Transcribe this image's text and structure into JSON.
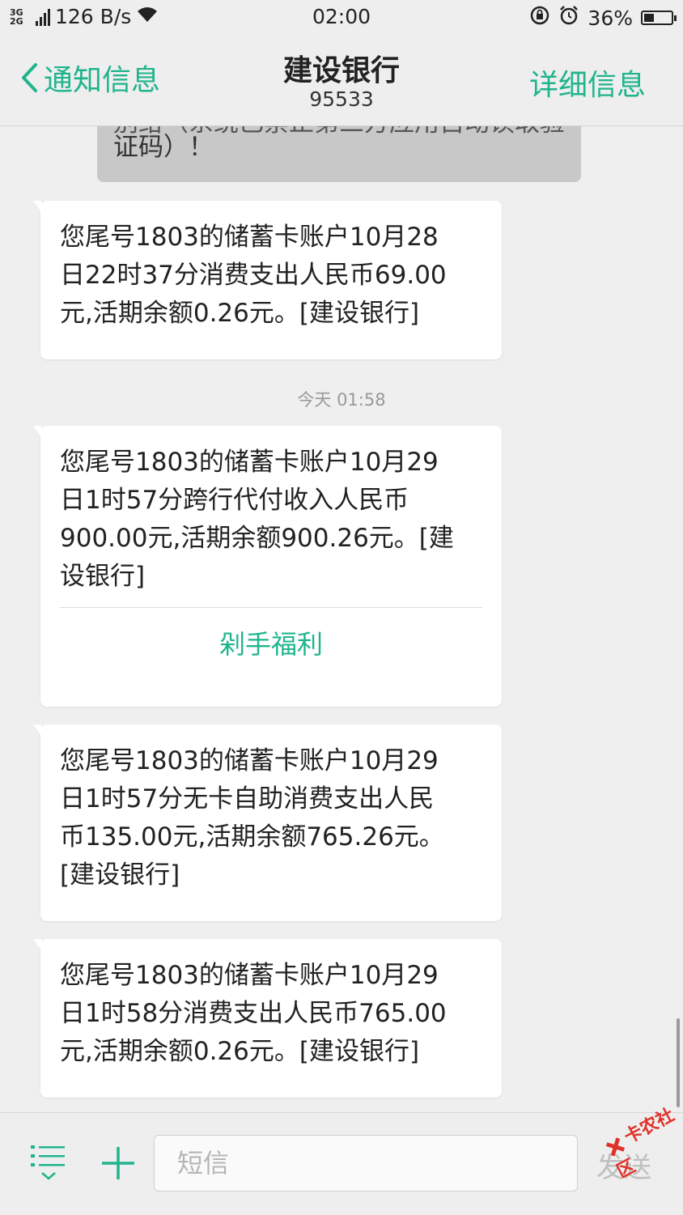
{
  "status_bar": {
    "network": "3G 2G",
    "speed": "126 B/s",
    "time": "02:00",
    "battery": "36%",
    "battery_level": 0.36
  },
  "header": {
    "back_label": "通知信息",
    "title": "建设银行",
    "subtitle": "95533",
    "detail_label": "详细信息"
  },
  "colors": {
    "accent": "#1fb48c",
    "background": "#efefef",
    "bubble": "#ffffff"
  },
  "messages": {
    "truncated": {
      "line1": "别给（系统已禁止第三方应用自动读取验",
      "line2": "证码）！"
    },
    "msg1": {
      "line1": "您尾号1803的储蓄卡账户10月28",
      "line2": "日22时37分消费支出人民币69.00",
      "line3": "元,活期余额0.26元。[建设银行]"
    },
    "timestamp": "今天 01:58",
    "msg2": {
      "line1": "您尾号1803的储蓄卡账户10月29",
      "line2": "日1时57分跨行代付收入人民币",
      "line3": "900.00元,活期余额900.26元。[建",
      "line4": "设银行]",
      "action": "剁手福利"
    },
    "msg3": {
      "line1": "您尾号1803的储蓄卡账户10月29",
      "line2": "日1时57分无卡自助消费支出人民",
      "line3": "币135.00元,活期余额765.26元。",
      "line4": "[建设银行]"
    },
    "msg4": {
      "line1": "您尾号1803的储蓄卡账户10月29",
      "line2": "日1时58分消费支出人民币765.00",
      "line3": "元,活期余额0.26元。[建设银行]"
    }
  },
  "composer": {
    "placeholder": "短信",
    "send_label": "发送",
    "watermark": "卡农社区"
  }
}
